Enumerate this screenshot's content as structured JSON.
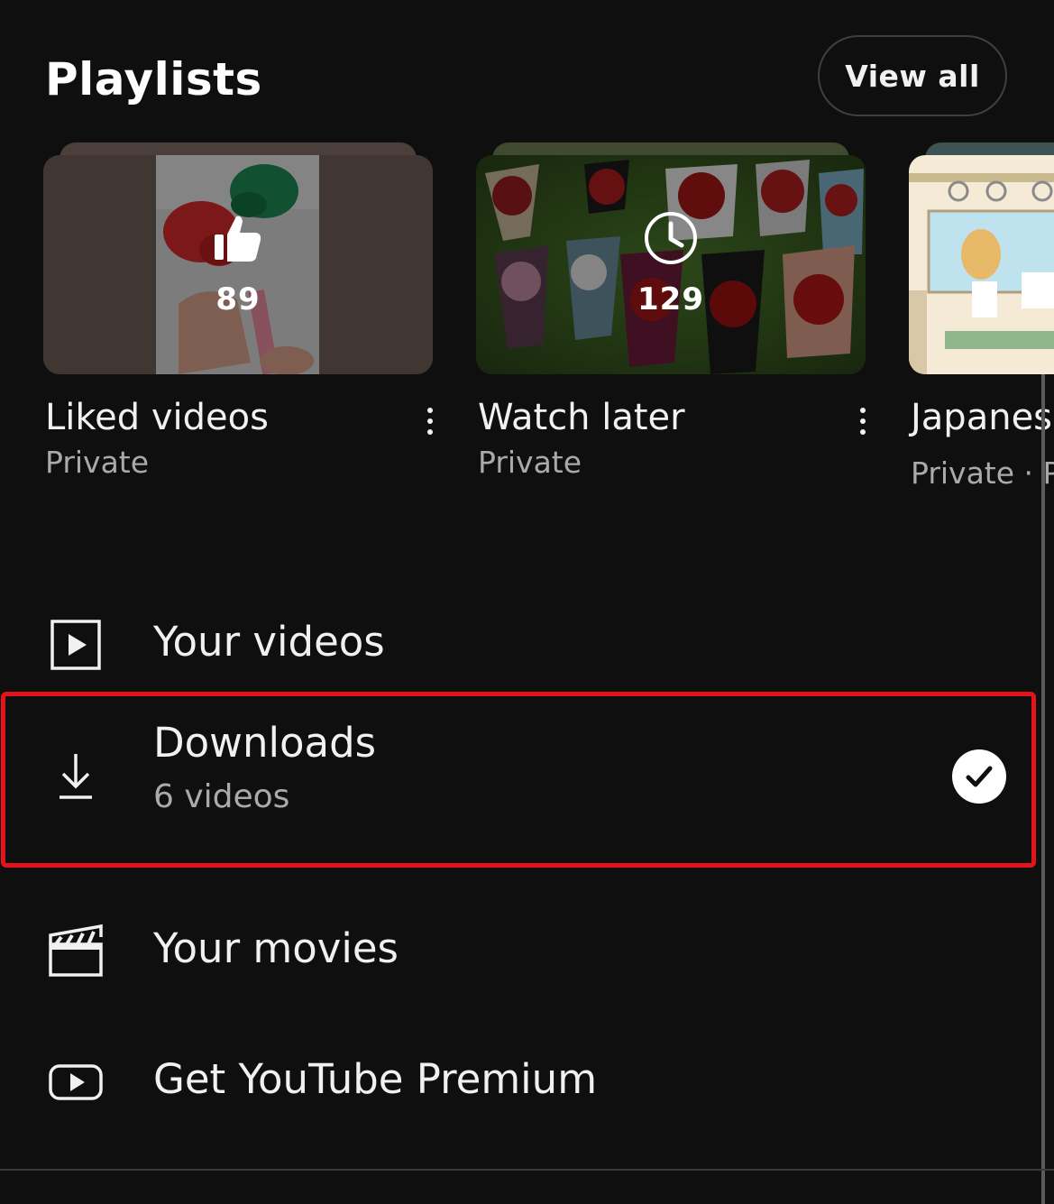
{
  "header": {
    "title": "Playlists",
    "view_all_label": "View all"
  },
  "playlists": [
    {
      "title": "Liked videos",
      "subtitle": "Private",
      "count": "89",
      "overlay_icon": "thumbs-up-icon"
    },
    {
      "title": "Watch later",
      "subtitle": "Private",
      "count": "129",
      "overlay_icon": "clock-icon"
    },
    {
      "title": "Japanes",
      "subtitle": "Private · P",
      "overlay_icon": ""
    }
  ],
  "menu": {
    "your_videos": {
      "label": "Your videos",
      "icon": "play-square-icon"
    },
    "downloads": {
      "label": "Downloads",
      "sub": "6 videos",
      "icon": "download-icon",
      "status_icon": "checkmark-icon"
    },
    "your_movies": {
      "label": "Your movies",
      "icon": "clapperboard-icon"
    },
    "premium": {
      "label": "Get YouTube Premium",
      "icon": "youtube-logo-icon"
    }
  },
  "colors": {
    "background": "#0f0f0f",
    "text_primary": "#f1f1f1",
    "text_secondary": "#aaaaaa",
    "highlight": "#e3131b"
  }
}
